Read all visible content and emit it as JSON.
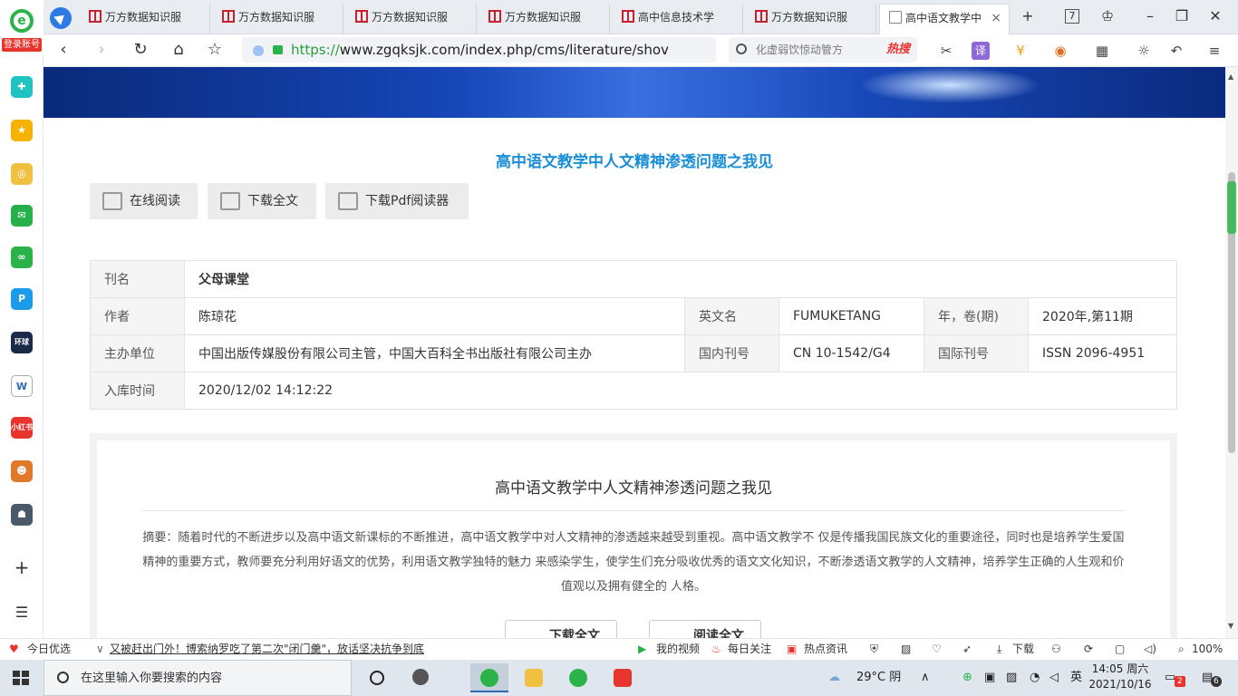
{
  "browser": {
    "login_label": "登录账号",
    "tabs": [
      {
        "label": "万方数据知识服"
      },
      {
        "label": "万方数据知识服"
      },
      {
        "label": "万方数据知识服"
      },
      {
        "label": "万方数据知识服"
      },
      {
        "label": "高中信息技术学"
      },
      {
        "label": "万方数据知识服"
      },
      {
        "label": "高中语文教学中"
      }
    ],
    "tab_count": "7",
    "url_scheme": "https://",
    "url_rest": "www.zgqksjk.com/index.php/cms/literature/shov",
    "search_placeholder": "化虚弱饮惊动管方",
    "search_hot": "热搜"
  },
  "page": {
    "title": "高中语文教学中人文精神渗透问题之我见",
    "actions": {
      "read_online": "在线阅读",
      "download_full": "下载全文",
      "download_pdf_reader": "下载Pdf阅读器"
    },
    "meta": {
      "journal_label": "刊名",
      "journal": "父母课堂",
      "author_label": "作者",
      "author": "陈琼花",
      "en_name_label": "英文名",
      "en_name": "FUMUKETANG",
      "year_label": "年，卷(期)",
      "year": "2020年,第11期",
      "sponsor_label": "主办单位",
      "sponsor": "中国出版传媒股份有限公司主管，中国大百科全书出版社有限公司主办",
      "cn_label": "国内刊号",
      "cn": "CN 10-1542/G4",
      "issn_label": "国际刊号",
      "issn": "ISSN 2096-4951",
      "added_label": "入库时间",
      "added": "2020/12/02 14:12:22"
    },
    "abstract_title": "高中语文教学中人文精神渗透问题之我见",
    "abstract": "摘要：随着时代的不断进步以及高中语文新课标的不断推进，高中语文教学中对人文精神的渗透越来越受到重视。高中语文教学不 仅是传播我国民族文化的重要途径，同时也是培养学生爱国精神的重要方式，教师要充分利用好语文的优势，利用语文教学独特的魅力 来感染学生，使学生们充分吸收优秀的语文文化知识，不断渗透语文教学的人文精神，培养学生正确的人生观和价值观以及拥有健全的 人格。",
    "download_btn": "下载全文",
    "read_btn": "阅读全文"
  },
  "statusbar": {
    "daily": "今日优选",
    "news": "又被赶出门外！博索纳罗吃了第二次\"闭门羹\"，放话坚决抗争到底",
    "video": "我的视频",
    "follow": "每日关注",
    "hotnews": "热点资讯",
    "download": "下载",
    "zoom": "100%"
  },
  "taskbar": {
    "search_placeholder": "在这里输入你要搜索的内容",
    "weather": "29°C 阴",
    "ime": "英",
    "time": "14:05 周六",
    "date": "2021/10/16",
    "notif_count": "2",
    "action_count": "6"
  },
  "colors": {
    "accent": "#1a8fd8",
    "brand_green": "#2bb34a",
    "hot_red": "#e8342c"
  }
}
